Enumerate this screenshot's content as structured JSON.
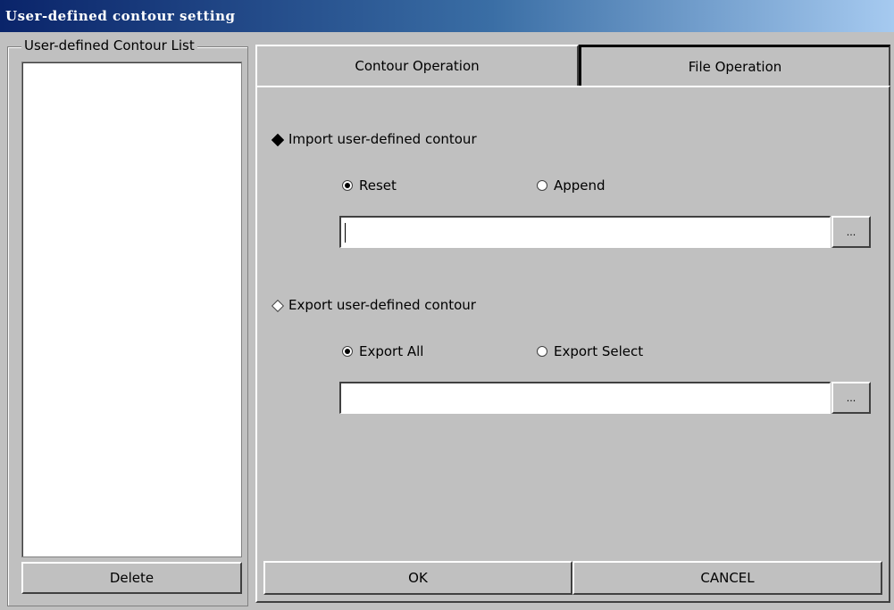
{
  "window": {
    "title": "User-defined contour setting"
  },
  "left": {
    "group_label": "User-defined Contour List",
    "items": [],
    "delete_label": "Delete"
  },
  "tabs": [
    {
      "label": "Contour Operation",
      "active": false
    },
    {
      "label": "File Operation",
      "active": true
    }
  ],
  "import": {
    "label": "Import user-defined contour",
    "selected": true,
    "options": [
      {
        "label": "Reset",
        "checked": true
      },
      {
        "label": "Append",
        "checked": false
      }
    ],
    "path_value": "",
    "browse_label": "..."
  },
  "export": {
    "label": "Export user-defined contour",
    "selected": false,
    "options": [
      {
        "label": "Export All",
        "checked": true
      },
      {
        "label": "Export Select",
        "checked": false
      }
    ],
    "path_value": "",
    "browse_label": "..."
  },
  "footer": {
    "ok_label": "OK",
    "cancel_label": "CANCEL"
  }
}
